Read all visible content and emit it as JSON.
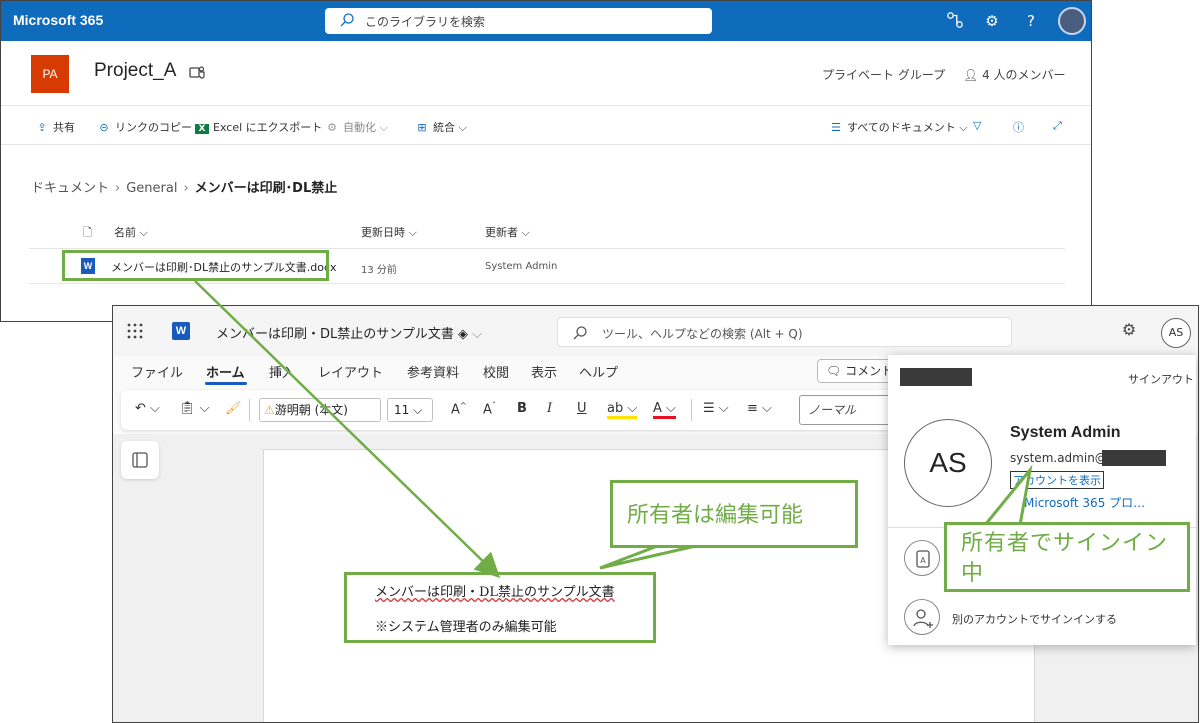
{
  "sharepoint": {
    "brand": "Microsoft 365",
    "search_placeholder": "このライブラリを検索",
    "site_badge": "PA",
    "site_title": "Project_A",
    "group_type": "プライベート グループ",
    "members": "4 人のメンバー",
    "commands": {
      "share": "共有",
      "copy_link": "リンクのコピー",
      "export_excel": "Excel にエクスポート",
      "automate": "自動化",
      "integrate": "統合",
      "all_docs": "すべてのドキュメント"
    },
    "breadcrumb": [
      "ドキュメント",
      "General",
      "メンバーは印刷･DL禁止"
    ],
    "columns": {
      "name": "名前",
      "modified": "更新日時",
      "modified_by": "更新者"
    },
    "rows": [
      {
        "name": "メンバーは印刷･DL禁止のサンプル文書.docx",
        "modified": "13 分前",
        "modified_by": "System Admin"
      }
    ]
  },
  "word": {
    "logo": "W",
    "doc_title": "メンバーは印刷・DL禁止のサンプル文書",
    "search_placeholder": "ツール、ヘルプなどの検索 (Alt + Q)",
    "avatar": "AS",
    "menus": [
      "ファイル",
      "ホーム",
      "挿入",
      "レイアウト",
      "参考資料",
      "校閲",
      "表示",
      "ヘルプ"
    ],
    "active_menu": "ホーム",
    "comment_button": "コメント",
    "font_name": "游明朝 (本文)",
    "font_size": "11",
    "style": "ノーマル",
    "doc_lines": [
      "メンバーは印刷・DL禁止のサンプル文書",
      "※システム管理者のみ編集可能"
    ]
  },
  "account": {
    "sign_out": "サインアウト",
    "initials": "AS",
    "name": "System Admin",
    "email_prefix": "system.admin@",
    "view_account": "アカウントを表示",
    "m365_link": "Microsoft 365 プロ…",
    "other_account": "別のアカウントでサインインする"
  },
  "annotations": {
    "owner_editable": "所有者は編集可能",
    "owner_signed_in": "所有者でサインイン中"
  },
  "colors": {
    "suite_bar": "#0f6cbd",
    "site_badge": "#d83b01",
    "annotation_green": "#70ad47",
    "word_blue": "#185abd"
  }
}
